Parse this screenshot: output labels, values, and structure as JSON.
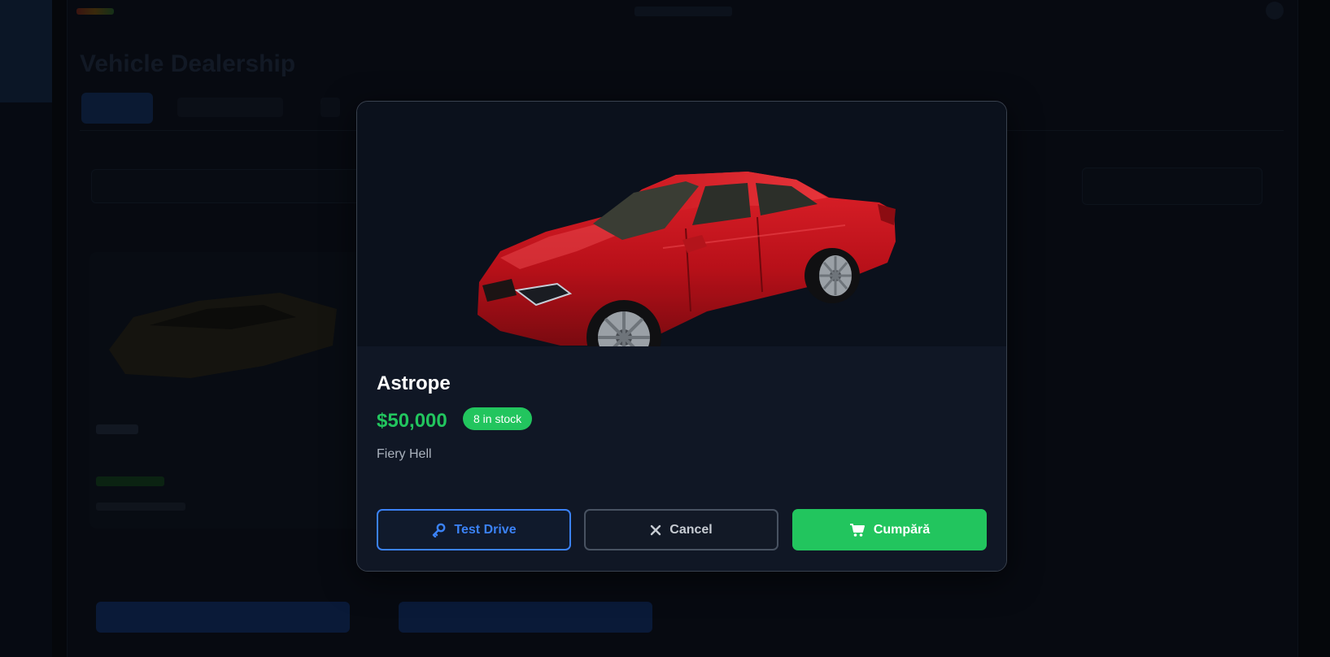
{
  "background": {
    "title": "Vehicle Dealership"
  },
  "modal": {
    "vehicle_name": "Astrope",
    "price": "$50,000",
    "stock_badge": "8 in stock",
    "color_name": "Fiery Hell",
    "image_icon": "car-image",
    "buttons": {
      "test_drive": {
        "label": "Test Drive",
        "icon": "key-icon"
      },
      "cancel": {
        "label": "Cancel",
        "icon": "close-icon"
      },
      "buy": {
        "label": "Cumpără",
        "icon": "cart-icon"
      }
    }
  },
  "colors": {
    "accent_blue": "#3b82f6",
    "accent_green": "#22c55e",
    "vehicle_paint": "#c8141c"
  }
}
